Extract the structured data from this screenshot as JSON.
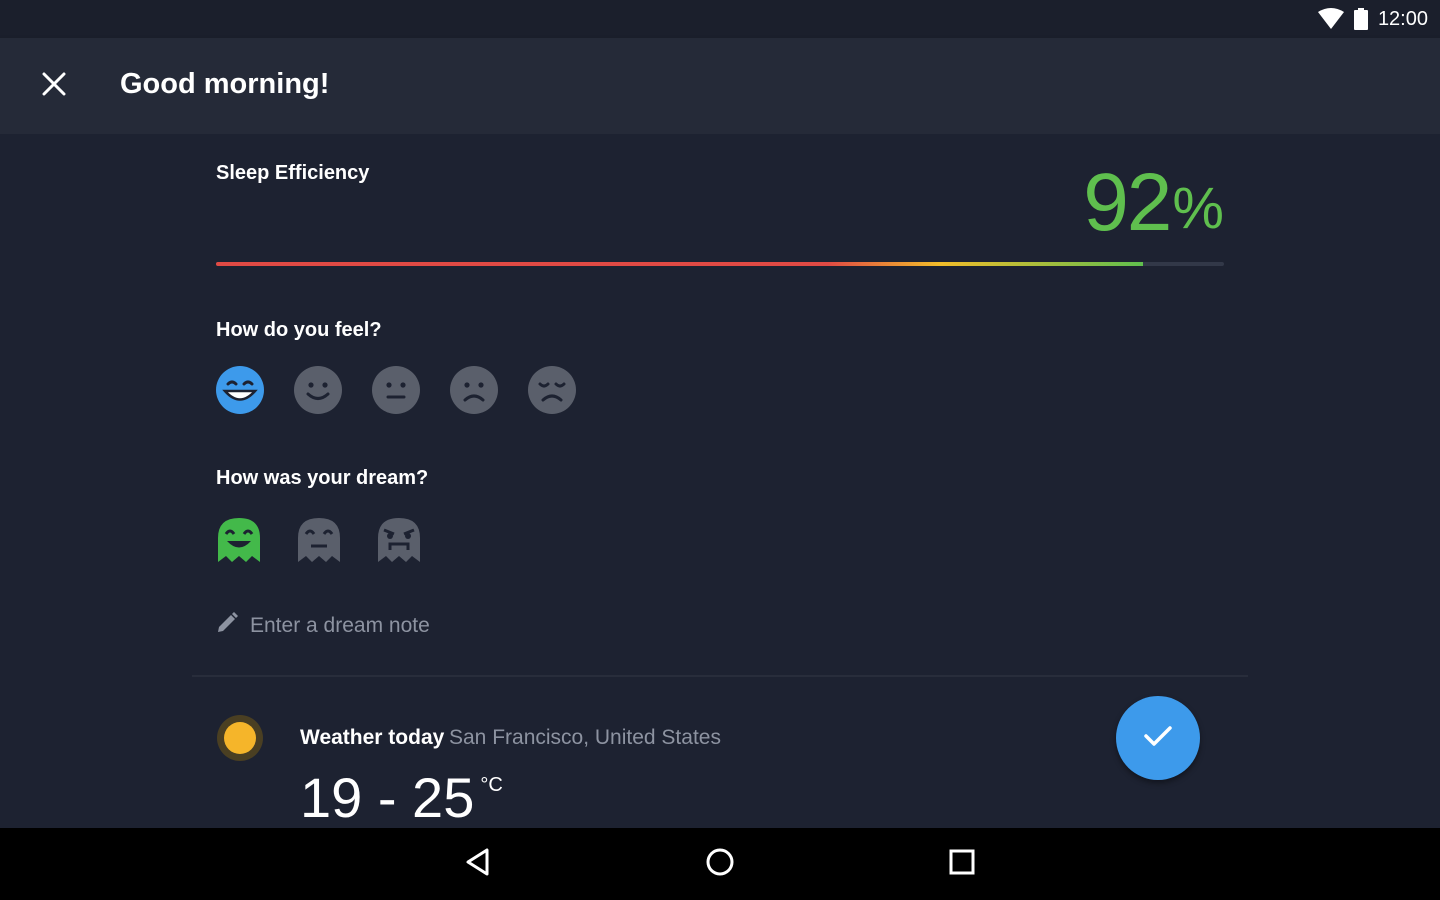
{
  "status_bar": {
    "time": "12:00",
    "icons": [
      "wifi-icon",
      "battery-icon"
    ]
  },
  "app_bar": {
    "title": "Good morning!",
    "close_icon": "close-icon"
  },
  "sleep_efficiency": {
    "label": "Sleep Efficiency",
    "value": "92",
    "unit": "%",
    "progress_fraction": 0.92,
    "bar_colors": [
      "#e04a44",
      "#f2bd2a",
      "#5fbf4e"
    ]
  },
  "mood": {
    "label": "How do you feel?",
    "options": [
      {
        "icon": "very-happy-face-icon",
        "selected": true,
        "color": "#3d9aeb"
      },
      {
        "icon": "happy-face-icon",
        "selected": false,
        "color": "#5a5f6b"
      },
      {
        "icon": "neutral-face-icon",
        "selected": false,
        "color": "#5a5f6b"
      },
      {
        "icon": "sad-face-icon",
        "selected": false,
        "color": "#5a5f6b"
      },
      {
        "icon": "very-sad-face-icon",
        "selected": false,
        "color": "#5a5f6b"
      }
    ]
  },
  "dream": {
    "label": "How was your dream?",
    "options": [
      {
        "icon": "good-dream-ghost-icon",
        "selected": true,
        "color": "#43b94a"
      },
      {
        "icon": "neutral-dream-ghost-icon",
        "selected": false,
        "color": "#5a5f6b"
      },
      {
        "icon": "bad-dream-ghost-icon",
        "selected": false,
        "color": "#5a5f6b"
      }
    ],
    "note_placeholder": "Enter a dream note",
    "note_icon": "pencil-icon"
  },
  "weather": {
    "title": "Weather today",
    "location": "San Francisco, United States",
    "temperature_range": "19 - 25",
    "unit": "°C",
    "icon": "sun-icon",
    "sun_color": "#f5b52a"
  },
  "fab": {
    "icon": "checkmark-icon",
    "color": "#3d9aeb"
  },
  "nav_bar": {
    "buttons": [
      "back-icon",
      "home-icon",
      "recents-icon"
    ]
  }
}
